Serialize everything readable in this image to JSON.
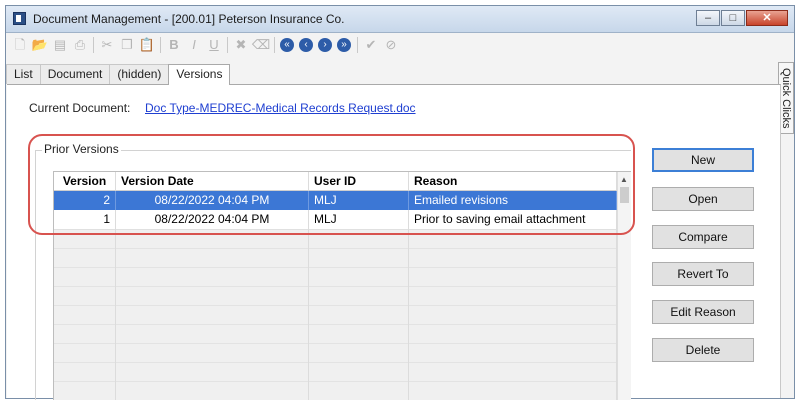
{
  "window": {
    "title": "Document Management - [200.01] Peterson Insurance Co.",
    "controls": {
      "minimize": "–",
      "maximize": "□",
      "close": "✕"
    }
  },
  "toolbar": {
    "icons": [
      "new-file-icon",
      "open-folder-icon",
      "save-icon",
      "print-icon",
      "cut-icon",
      "copy-icon",
      "paste-icon",
      "bold-icon",
      "italic-icon",
      "underline-icon",
      "delete-icon",
      "clear-icon",
      "first-record-icon",
      "previous-record-icon",
      "next-record-icon",
      "last-record-icon",
      "accept-icon",
      "cancel-icon"
    ],
    "glyphs": {
      "new": "🗋",
      "open": "📂",
      "save": "▤",
      "print": "⎙",
      "cut": "✂",
      "copy": "❐",
      "paste": "📋",
      "bold": "B",
      "italic": "I",
      "underline": "U",
      "delete": "✖",
      "clear": "⌫",
      "first": "«",
      "prev": "‹",
      "next": "›",
      "last": "»",
      "accept": "✔",
      "cancel": "⊘"
    }
  },
  "tabs": [
    {
      "label": "List"
    },
    {
      "label": "Document"
    },
    {
      "label": "(hidden)"
    },
    {
      "label": "Versions",
      "active": true
    }
  ],
  "quick_clicks": "Quick Clicks",
  "current_document": {
    "label": "Current Document:",
    "link": "Doc Type-MEDREC-Medical Records Request.doc"
  },
  "prior_versions": {
    "group_label": "Prior Versions",
    "columns": [
      "Version",
      "Version Date",
      "User ID",
      "Reason"
    ],
    "rows": [
      {
        "version": "2",
        "date": "08/22/2022 04:04 PM",
        "user": "MLJ",
        "reason": "Emailed revisions",
        "selected": true
      },
      {
        "version": "1",
        "date": "08/22/2022 04:04 PM",
        "user": "MLJ",
        "reason": "Prior to saving email attachment",
        "selected": false
      }
    ],
    "scroll_up_glyph": "▲"
  },
  "buttons": {
    "new": "New",
    "open": "Open",
    "compare": "Compare",
    "revert": "Revert To",
    "edit_reason": "Edit Reason",
    "delete": "Delete"
  },
  "colors": {
    "selection": "#3c77d5",
    "link": "#1f3fd1",
    "highlight_box": "#d8534f",
    "default_button_border": "#3c7fd6"
  }
}
